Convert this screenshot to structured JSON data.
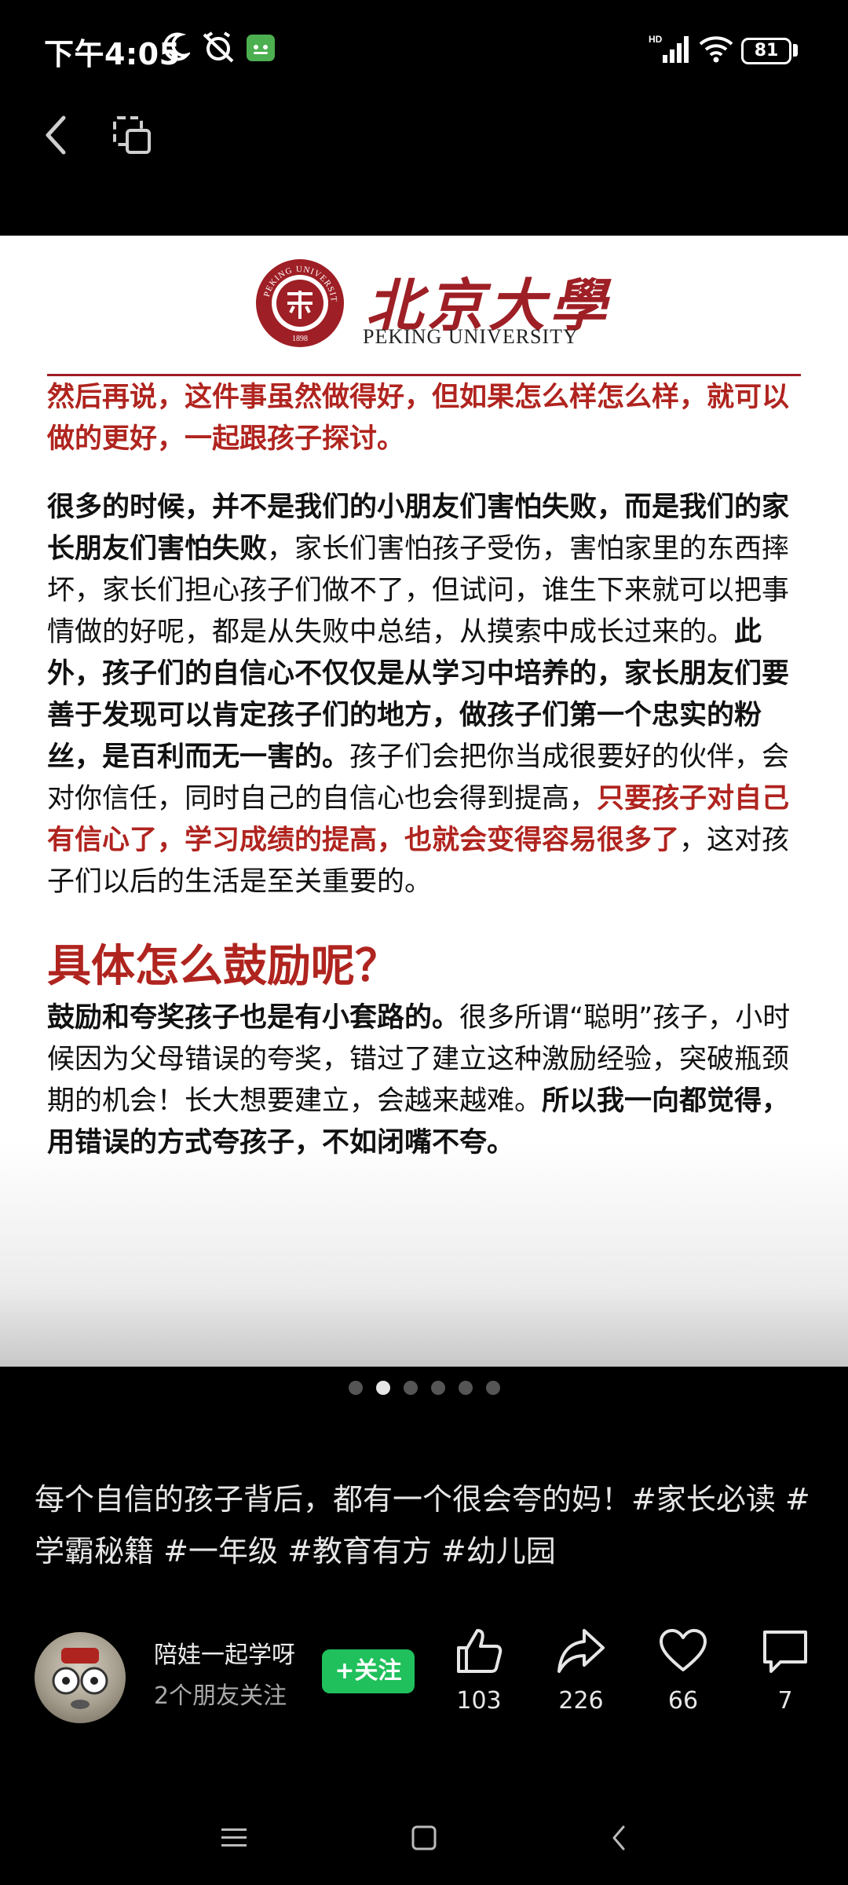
{
  "status_bar": {
    "time": "下午4:05",
    "network": "HD",
    "battery": "81"
  },
  "card": {
    "logo_cn": "北京大學",
    "logo_en": "PEKING UNIVERSITY",
    "seal_text": "PEKING UNIVERSITY",
    "seal_year": "1898",
    "intro": "然后再说，这件事虽然做得好，但如果怎么样怎么样，就可以做的更好，一起跟孩子探讨。",
    "para1_bold": "很多的时候，并不是我们的小朋友们害怕失败，而是我们的家长朋友们害怕失败",
    "para1_normal": "，家长们害怕孩子受伤，害怕家里的东西摔坏，家长们担心孩子们做不了，但试问，谁生下来就可以把事情做的好呢，都是从失败中总结，从摸索中成长过来的。",
    "para1_bold2": "此外，孩子们的自信心不仅仅是从学习中培养的，家长朋友们要善于发现可以肯定孩子们的地方，做孩子们第一个忠实的粉丝，是百利而无一害的。",
    "para1_normal2": "孩子们会把你当成很要好的伙伴，会对你信任，同时自己的自信心也会得到提高，",
    "para1_red": "只要孩子对自己有信心了，学习成绩的提高，也就会变得容易很多了",
    "para1_end": "，这对孩子们以后的生活是至关重要的。",
    "subheading": "具体怎么鼓励呢？",
    "para2_bold": "鼓励和夸奖孩子也是有小套路的。",
    "para2_normal": "很多所谓“聪明”孩子，小时候因为父母错误的夸奖，错过了建立这种激励经验，突破瓶颈期的机会！长大想要建立，会越来越难。",
    "para2_bold2": "所以我一向都觉得，用错误的方式夸孩子，不如闭嘴不夸。"
  },
  "carousel": {
    "total": 6,
    "active_index": 1
  },
  "caption": "每个自信的孩子背后，都有一个很会夸的妈！#家长必读 #学霸秘籍 #一年级 #教育有方 #幼儿园",
  "author": {
    "name": "陪娃一起学呀",
    "subtitle": "2个朋友关注",
    "follow_label": "+关注"
  },
  "actions": {
    "like_count": "103",
    "share_count": "226",
    "favorite_count": "66",
    "comment_count": "7"
  },
  "colors": {
    "accent_red": "#b0241f",
    "follow_green": "#20c05c"
  }
}
